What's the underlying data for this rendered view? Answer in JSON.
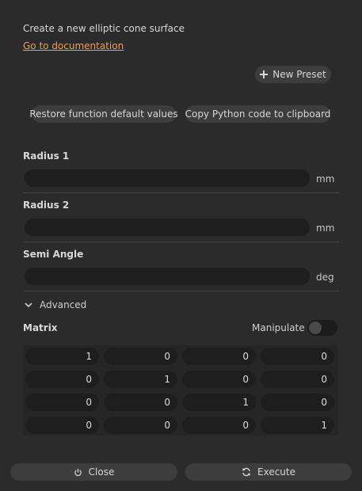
{
  "header": {
    "description": "Create a new elliptic cone surface",
    "doc_link": "Go to documentation"
  },
  "toolbar": {
    "new_preset_label": "New Preset",
    "new_preset_icon": "plus-icon",
    "restore_label": "Restore function default values",
    "copy_label": "Copy Python code to clipboard"
  },
  "fields": [
    {
      "label": "Radius 1",
      "value": "",
      "unit": "mm"
    },
    {
      "label": "Radius 2",
      "value": "",
      "unit": "mm"
    },
    {
      "label": "Semi Angle",
      "value": "",
      "unit": "deg"
    }
  ],
  "advanced": {
    "label": "Advanced",
    "expanded": true,
    "matrix_label": "Matrix",
    "manipulate_label": "Manipulate",
    "manipulate_on": false,
    "matrix": [
      [
        "1",
        "0",
        "0",
        "0"
      ],
      [
        "0",
        "1",
        "0",
        "0"
      ],
      [
        "0",
        "0",
        "1",
        "0"
      ],
      [
        "0",
        "0",
        "0",
        "1"
      ]
    ]
  },
  "footer": {
    "close_label": "Close",
    "close_icon": "power-icon",
    "execute_label": "Execute",
    "execute_icon": "refresh-icon"
  },
  "colors": {
    "background": "#2b2b2b",
    "link": "#f0a23c",
    "input_bg": "#1e1e1e",
    "button_bg": "#3d3d3d"
  }
}
